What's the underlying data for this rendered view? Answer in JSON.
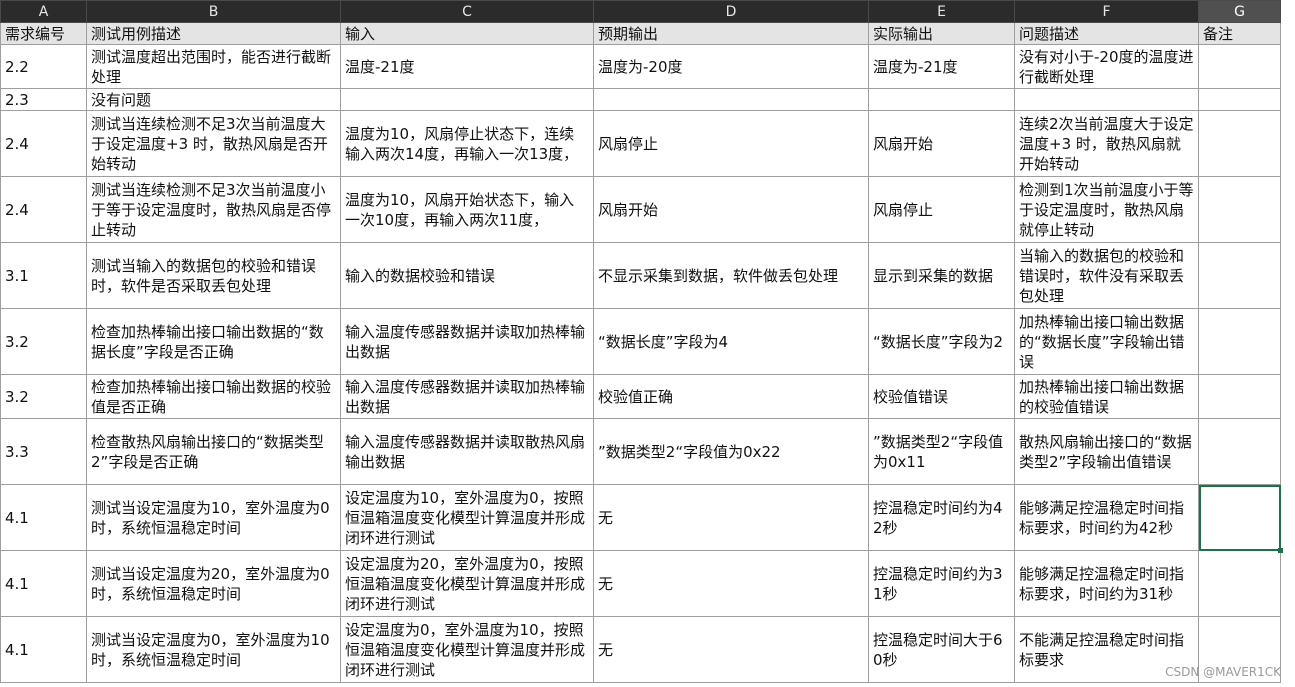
{
  "column_letters": [
    "A",
    "B",
    "C",
    "D",
    "E",
    "F",
    "G"
  ],
  "header": [
    "需求编号",
    "测试用例描述",
    "输入",
    "预期输出",
    "实际输出",
    "问题描述",
    "备注"
  ],
  "rows": [
    [
      "2.2",
      "测试温度超出范围时，能否进行截断处理",
      "温度-21度",
      "温度为-20度",
      "温度为-21度",
      "没有对小于-20度的温度进行截断处理"
    ],
    [
      "2.3",
      "没有问题",
      "",
      "",
      "",
      ""
    ],
    [
      "2.4",
      "测试当连续检测不足3次当前温度大于设定温度+3 时，散热风扇是否开始转动",
      "温度为10，风扇停止状态下，连续输入两次14度，再输入一次13度，",
      "风扇停止",
      "风扇开始",
      "连续2次当前温度大于设定温度+3 时，散热风扇就开始转动"
    ],
    [
      "2.4",
      "测试当连续检测不足3次当前温度小于等于设定温度时，散热风扇是否停止转动",
      "温度为10，风扇开始状态下，输入一次10度，再输入两次11度，",
      "风扇开始",
      "风扇停止",
      "检测到1次当前温度小于等于设定温度时，散热风扇就停止转动"
    ],
    [
      "3.1",
      "测试当输入的数据包的校验和错误时，软件是否采取丢包处理",
      "输入的数据校验和错误",
      "不显示采集到数据，软件做丢包处理",
      "显示到采集的数据",
      "当输入的数据包的校验和错误时，软件没有采取丢包处理"
    ],
    [
      "3.2",
      "检查加热棒输出接口输出数据的“数据长度”字段是否正确",
      "输入温度传感器数据并读取加热棒输出数据",
      "“数据长度”字段为4",
      "“数据长度”字段为2",
      "加热棒输出接口输出数据的“数据长度”字段输出错误"
    ],
    [
      "3.2",
      "检查加热棒输出接口输出数据的校验值是否正确",
      "输入温度传感器数据并读取加热棒输出数据",
      "校验值正确",
      "校验值错误",
      "加热棒输出接口输出数据的校验值错误"
    ],
    [
      "3.3",
      "检查散热风扇输出接口的“数据类型2”字段是否正确",
      "输入温度传感器数据并读取散热风扇输出数据",
      "”数据类型2“字段值为0x22",
      "”数据类型2“字段值为0x11",
      "散热风扇输出接口的“数据类型2”字段输出值错误"
    ],
    [
      "4.1",
      "测试当设定温度为10，室外温度为0时，系统恒温稳定时间",
      "设定温度为10，室外温度为0，按照恒温箱温度变化模型计算温度并形成闭环进行测试",
      "无",
      "控温稳定时间约为42秒",
      "能够满足控温稳定时间指标要求，时间约为42秒"
    ],
    [
      "4.1",
      "测试当设定温度为20，室外温度为0时，系统恒温稳定时间",
      "设定温度为20，室外温度为0，按照恒温箱温度变化模型计算温度并形成闭环进行测试",
      "无",
      "控温稳定时间约为31秒",
      "能够满足控温稳定时间指标要求，时间约为31秒"
    ],
    [
      "4.1",
      "测试当设定温度为0，室外温度为10时，系统恒温稳定时间",
      "设定温度为0，室外温度为10，按照恒温箱温度变化模型计算温度并形成闭环进行测试",
      "无",
      "控温稳定时间大于60秒",
      "不能满足控温稳定时间指标要求"
    ]
  ],
  "watermark": "CSDN @MAVER1CK",
  "colors": {
    "header_bar": "#2b2b2b",
    "selection": "#1e7145"
  }
}
